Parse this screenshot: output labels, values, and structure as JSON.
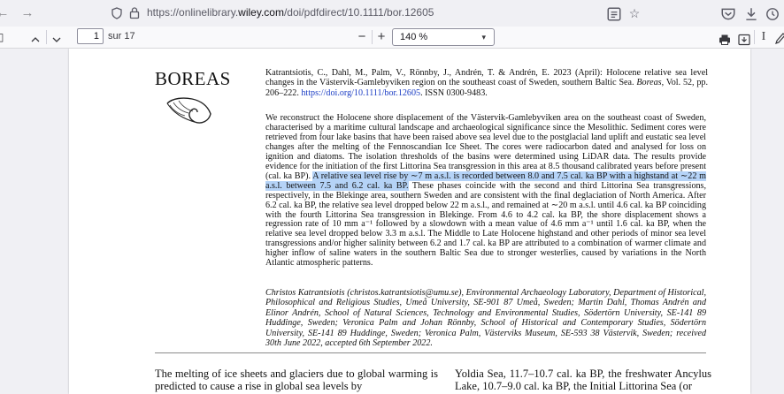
{
  "browser": {
    "url_prefix": "https://onlinelibrary.",
    "url_domain": "wiley.com",
    "url_suffix": "/doi/pdfdirect/10.1111/bor.12605"
  },
  "pdf_toolbar": {
    "current_page": "1",
    "page_total": "sur 17",
    "zoom": "140 %"
  },
  "document": {
    "journal_name": "BOREAS",
    "citation_text": "Katrantsiotis, C., Dahl, M., Palm, V., Rönnby, J., Andrén, T. & Andrén, E. 2023 (April): Holocene relative sea level changes in the Västervik-Gamlebyviken region on the southeast coast of Sweden, southern Baltic Sea. ",
    "citation_journal": "Boreas",
    "citation_vol": ", Vol. 52, pp. 206–222. ",
    "citation_doi": "https://doi.org/10.1111/bor.12605",
    "citation_issn": ". ISSN 0300-9483.",
    "abstract_part1": "We reconstruct the Holocene shore displacement of the Västervik-Gamlebyviken area on the southeast coast of Sweden, characterised by a maritime cultural landscape and archaeological significance since the Mesolithic. Sediment cores were retrieved from four lake basins that have been raised above sea level due to the postglacial land uplift and eustatic sea level changes after the melting of the Fennoscandian Ice Sheet. The cores were radiocarbon dated and analysed for loss on ignition and diatoms. The isolation thresholds of the basins were determined using LiDAR data. The results provide evidence for the initiation of the first Littorina Sea transgression in this area at 8.5 thousand calibrated years before present (cal. ka BP). ",
    "abstract_highlight": "A relative sea level rise by ∼7 m a.s.l. is recorded between 8.0 and 7.5 cal. ka BP with a highstand at ∼22 m a.s.l. between 7.5 and 6.2 cal. ka BP.",
    "abstract_part2": " These phases coincide with the second and third Littorina Sea transgressions, respectively, in the Blekinge area, southern Sweden and are consistent with the final deglaciation of North America. After 6.2 cal. ka BP, the relative sea level dropped below 22 m a.s.l., and remained at ∼20 m a.s.l. until 4.6 cal. ka BP coinciding with the fourth Littorina Sea transgression in Blekinge. From 4.6 to 4.2 cal. ka BP, the shore displacement shows a regression rate of 10 mm a⁻¹ followed by a slowdown with a mean value of 4.6 mm a⁻¹ until 1.6 cal. ka BP, when the relative sea level dropped below 3.3 m a.s.l. The Middle to Late Holocene highstand and other periods of minor sea level transgressions and/or higher salinity between 6.2 and 1.7 cal. ka BP are attributed to a combination of warmer climate and higher inflow of saline waters in the southern Baltic Sea due to stronger westerlies, caused by variations in the North Atlantic atmospheric patterns.",
    "affiliation": "Christos Katrantsiotis (christos.katrantsiotis@umu.se), Environmental Archaeology Laboratory, Department of Historical, Philosophical and Religious Studies, Umeå University, SE-901 87 Umeå, Sweden; Martin Dahl, Thomas Andrén and Elinor Andrén, School of Natural Sciences, Technology and Environmental Studies, Södertörn University, SE-141 89 Huddinge, Sweden; Veronica Palm and Johan Rönnby, School of Historical and Contemporary Studies, Södertörn University, SE-141 89 Huddinge, Sweden; Veronica Palm, Västerviks Museum, SE-593 38 Västervik, Sweden; received 30th June 2022, accepted 6th September 2022.",
    "body_col1": "The melting of ice sheets and glaciers due to global warming is predicted to cause a rise in global sea levels by",
    "body_col2": "Yoldia Sea, 11.7–10.7 cal. ka BP, the freshwater Ancylus Lake, 10.7–9.0 cal. ka BP, the Initial Littorina Sea (or"
  }
}
